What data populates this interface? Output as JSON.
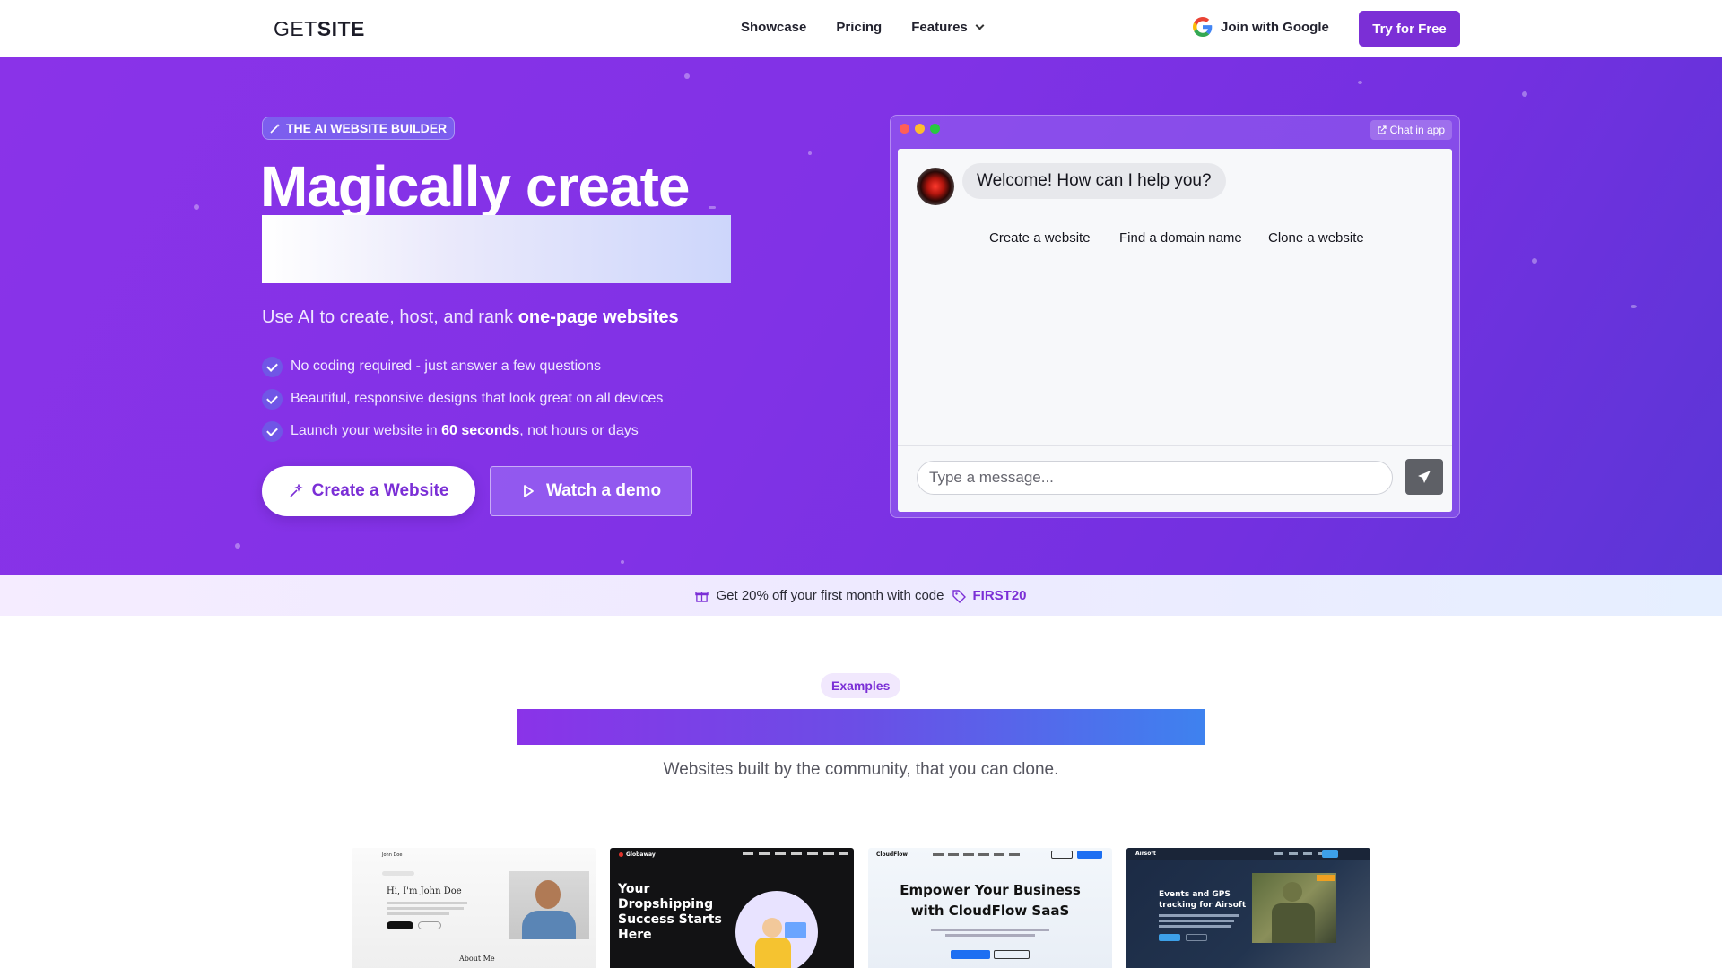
{
  "nav": {
    "logo_light": "GET",
    "logo_bold": "SITE",
    "links": [
      "Showcase",
      "Pricing",
      "Features"
    ],
    "join_google": "Join with Google",
    "try_free": "Try for Free"
  },
  "hero": {
    "badge": "THE AI WEBSITE BUILDER",
    "headline": "Magically create",
    "subline_plain": "Use AI to create, host, and rank ",
    "subline_bold": "one-page websites",
    "features": [
      {
        "pre": "No coding required - just answer a few questions",
        "bold": "",
        "post": ""
      },
      {
        "pre": "Beautiful, responsive designs that look great on all devices",
        "bold": "",
        "post": ""
      },
      {
        "pre": "Launch your website in ",
        "bold": "60 seconds",
        "post": ", not hours or days"
      }
    ],
    "cta_create": "Create a Website",
    "cta_demo": "Watch a demo"
  },
  "chat": {
    "chat_in_app": "Chat in app",
    "welcome": "Welcome! How can I help you?",
    "suggestions": [
      "Create a website",
      "Find a domain name",
      "Clone a website"
    ],
    "input_placeholder": "Type a message..."
  },
  "promo": {
    "text": "Get 20% off your first month with code",
    "code": "FIRST20"
  },
  "examples": {
    "chip": "Examples",
    "subtitle": "Websites built by the community, that you can clone.",
    "thumbs": [
      {
        "brand": "John Doe",
        "title": "Hi, I'm John Doe",
        "footer": "About Me"
      },
      {
        "brand": "Globaway",
        "title": "Your Dropshipping Success Starts Here"
      },
      {
        "brand": "CloudFlow",
        "title": "Empower Your Business with CloudFlow SaaS"
      },
      {
        "brand": "Airsoft",
        "title": "Events and GPS tracking for Airsoft"
      }
    ]
  },
  "colors": {
    "brand": "#7b2fd6",
    "hero_start": "#8a33e8",
    "hero_end": "#5b36d6"
  }
}
